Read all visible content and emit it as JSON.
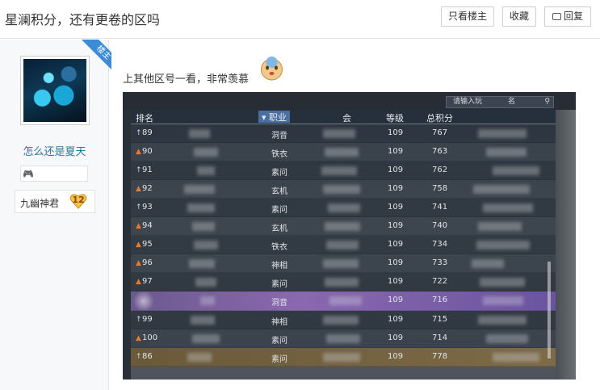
{
  "header": {
    "title": "星澜积分，还有更卷的区吗",
    "buttons": {
      "only_op": "只看楼主",
      "favorite": "收藏",
      "reply": "回复"
    }
  },
  "user": {
    "op_ribbon": "楼主",
    "name": "怎么还是夏天",
    "game_badge_icon": "🎮",
    "title": "九幽神君",
    "level": "12"
  },
  "post": {
    "text": "上其他区号一看，非常羡慕",
    "emoji": "envy-face-emoji"
  },
  "game_screenshot": {
    "search_placeholder": "请输入玩",
    "search_suffix": "名",
    "columns": {
      "rank": "排名",
      "job": "职业",
      "guild": "会",
      "level": "等级",
      "score": "总积分"
    },
    "rows": [
      {
        "trend": "up",
        "rank": "89",
        "job": "洞音",
        "level": "109",
        "score": "767",
        "style": "normal"
      },
      {
        "trend": "fire",
        "rank": "90",
        "job": "铁衣",
        "level": "109",
        "score": "763",
        "style": "normal"
      },
      {
        "trend": "up",
        "rank": "91",
        "job": "素问",
        "level": "109",
        "score": "762",
        "style": "normal"
      },
      {
        "trend": "fire",
        "rank": "92",
        "job": "玄机",
        "level": "109",
        "score": "758",
        "style": "normal"
      },
      {
        "trend": "up",
        "rank": "93",
        "job": "素问",
        "level": "109",
        "score": "741",
        "style": "normal"
      },
      {
        "trend": "fire",
        "rank": "94",
        "job": "玄机",
        "level": "109",
        "score": "740",
        "style": "normal"
      },
      {
        "trend": "fire",
        "rank": "95",
        "job": "铁衣",
        "level": "109",
        "score": "734",
        "style": "normal"
      },
      {
        "trend": "fire",
        "rank": "96",
        "job": "神相",
        "level": "109",
        "score": "733",
        "style": "normal"
      },
      {
        "trend": "fire",
        "rank": "97",
        "job": "素问",
        "level": "109",
        "score": "722",
        "style": "normal"
      },
      {
        "trend": "",
        "rank": "",
        "job": "洞音",
        "level": "109",
        "score": "716",
        "style": "purple"
      },
      {
        "trend": "up",
        "rank": "99",
        "job": "神相",
        "level": "109",
        "score": "715",
        "style": "normal"
      },
      {
        "trend": "fire",
        "rank": "100",
        "job": "素问",
        "level": "109",
        "score": "714",
        "style": "normal"
      },
      {
        "trend": "up",
        "rank": "86",
        "job": "素问",
        "level": "109",
        "score": "778",
        "style": "gold"
      }
    ]
  },
  "colors": {
    "username": "#2b7a9b",
    "op_ribbon": "#3b8bd6",
    "highlight_purple": "#8a68b0",
    "highlight_gold": "#7d6a46"
  }
}
